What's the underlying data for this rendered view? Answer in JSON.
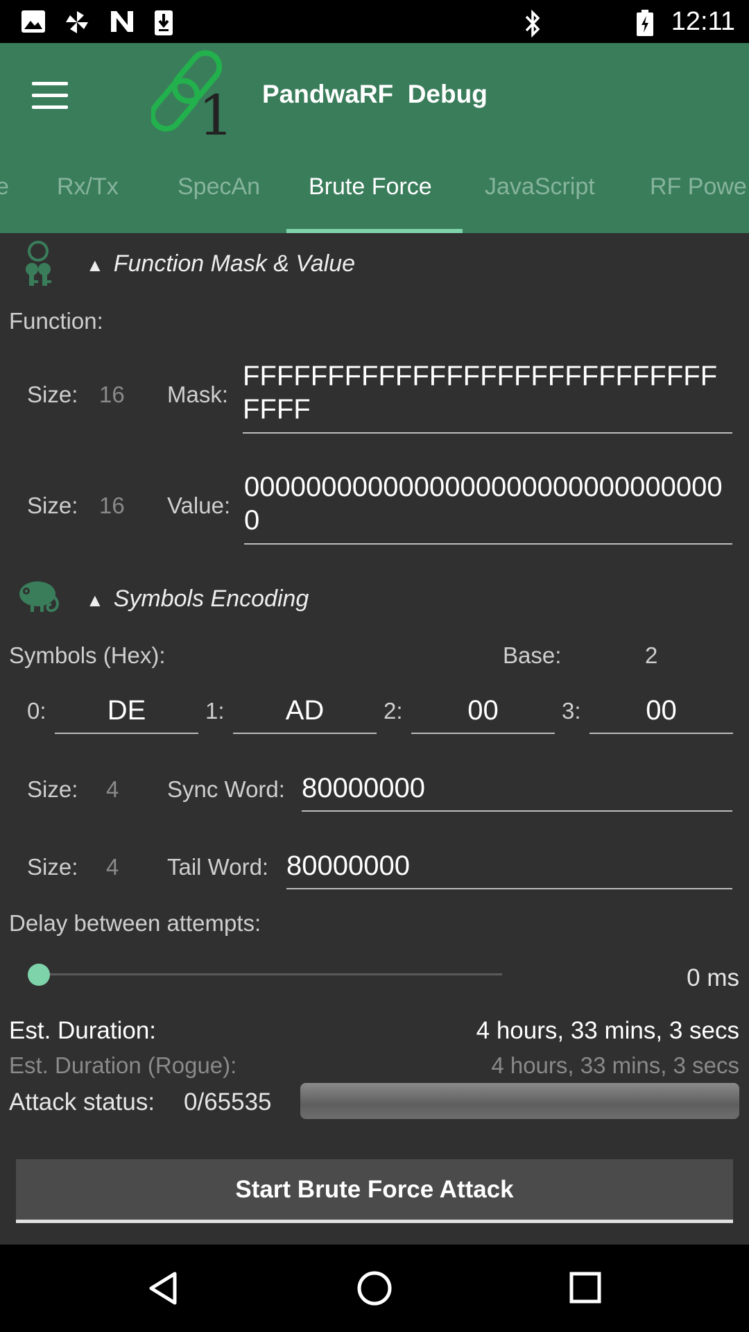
{
  "status_bar": {
    "time": "12:11"
  },
  "app": {
    "title": "PandwaRF  Debug"
  },
  "tabs": [
    {
      "label": "Rx/Tx"
    },
    {
      "label": "SpecAn"
    },
    {
      "label": "Brute Force"
    },
    {
      "label": "JavaScript"
    },
    {
      "label": "RF Powe"
    }
  ],
  "function_section": {
    "title": "Function Mask & Value",
    "function_label": "Function:",
    "mask": {
      "size_label": "Size:",
      "size_value": "16",
      "label": "Mask:",
      "value": "FFFFFFFFFFFFFFFFFFFFFFFFFFFFFFFF"
    },
    "value": {
      "size_label": "Size:",
      "size_value": "16",
      "label": "Value:",
      "value": "00000000000000000000000000000000"
    }
  },
  "symbols_section": {
    "title": "Symbols Encoding",
    "symbols_label": "Symbols (Hex):",
    "base_label": "Base:",
    "base_value": "2",
    "symbols": [
      {
        "index": "0:",
        "value": "DE"
      },
      {
        "index": "1:",
        "value": "AD"
      },
      {
        "index": "2:",
        "value": "00"
      },
      {
        "index": "3:",
        "value": "00"
      }
    ],
    "sync": {
      "size_label": "Size:",
      "size_value": "4",
      "label": "Sync Word:",
      "value": "80000000"
    },
    "tail": {
      "size_label": "Size:",
      "size_value": "4",
      "label": "Tail Word:",
      "value": "80000000"
    }
  },
  "delay": {
    "label": "Delay between attempts:",
    "value": "0 ms",
    "slider_fraction": 0
  },
  "estimates": {
    "duration_label": "Est. Duration:",
    "duration_value": "4 hours, 33 mins, 3 secs",
    "rogue_label": "Est. Duration (Rogue):",
    "rogue_value": "4 hours, 33 mins, 3 secs"
  },
  "attack": {
    "status_label": "Attack status:",
    "status_value": "0/65535",
    "progress_fraction": 0
  },
  "start_button": {
    "label": "Start Brute Force Attack"
  },
  "colors": {
    "accent": "#3a7d5b",
    "indicator": "#7fd3aa",
    "background": "#303030"
  },
  "icons": [
    "image-icon",
    "pinwheel-icon",
    "n-logo-icon",
    "download-icon",
    "bluetooth-icon",
    "battery-icon",
    "menu-icon",
    "chain-logo-icon",
    "keys-icon",
    "chameleon-icon",
    "back-icon",
    "home-icon",
    "recents-icon"
  ]
}
